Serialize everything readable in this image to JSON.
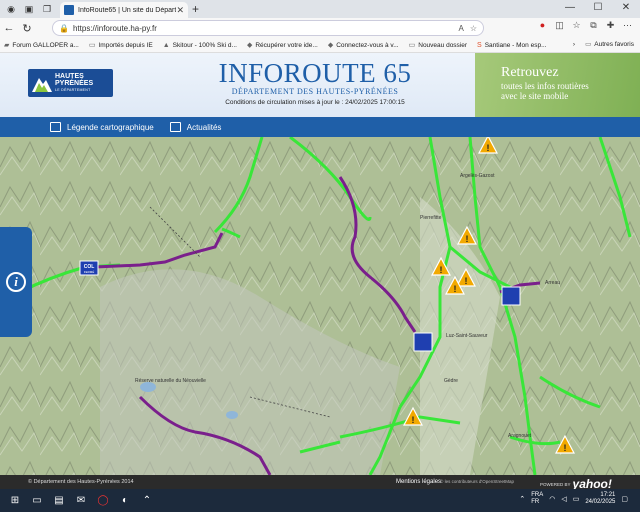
{
  "browser": {
    "tab_title": "InfoRoute65 | Un site du Départem",
    "url": "https://inforoute.ha-py.fr",
    "bookmarks": [
      {
        "label": "Forum GALLOPER a..."
      },
      {
        "label": "Importés depuis IE"
      },
      {
        "label": "Skitour - 100% Ski d..."
      },
      {
        "label": "Récupérer votre ide..."
      },
      {
        "label": "Connectez-vous à v..."
      },
      {
        "label": "Nouveau dossier"
      },
      {
        "label": "Santiane - Mon esp..."
      }
    ],
    "other_favorites": "Autres favoris"
  },
  "header": {
    "logo_line1": "HAUTES",
    "logo_line2": "PYRÉNÉES",
    "logo_sub": "LE DÉPARTEMENT",
    "title": "INFOROUTE 65",
    "subtitle": "DÉPARTEMENT DES HAUTES-PYRÉNÉES",
    "update": "Conditions de circulation mises à jour le : 24/02/2025 17:00:15",
    "promo_line1": "Retrouvez",
    "promo_line2": "toutes les infos routières",
    "promo_line3": "avec le site mobile"
  },
  "nav": {
    "legend": "Légende cartographique",
    "news": "Actualités"
  },
  "map": {
    "col_label": "COL",
    "col_sub": "FERMÉ",
    "places": [
      "Argelès-Gazost",
      "Pierrefitte",
      "Luz-Saint-Sauveur",
      "Gèdre",
      "Réserve naturelle du Néouvielle",
      "Arreau",
      "Aragnouet"
    ],
    "warning_color": "#f2a900",
    "open_road_color": "#39e639",
    "closed_road_color": "#7a1f8c"
  },
  "footer": {
    "copyright": "© Département des Hautes-Pyrénées 2014",
    "legal": "Mentions légales",
    "osm": "© les contributeurs d'OpenStreetMap",
    "powered": "POWERED BY",
    "yahoo": "yahoo!"
  },
  "taskbar": {
    "lang1": "FRA",
    "lang2": "FR",
    "time": "17:21",
    "date": "24/02/2025"
  }
}
